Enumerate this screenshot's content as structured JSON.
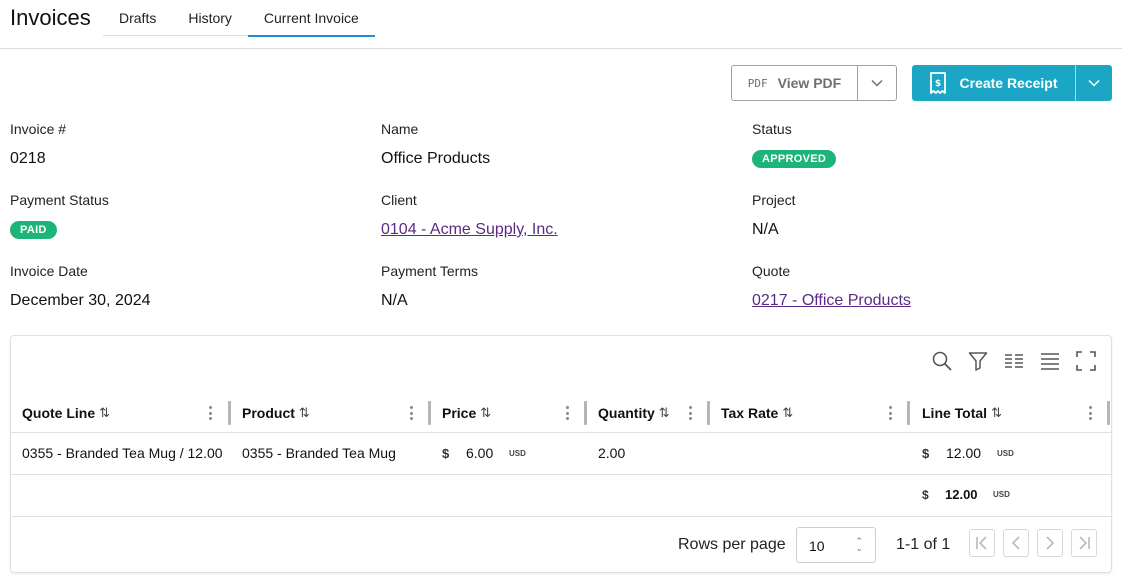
{
  "app": {
    "title": "Invoices"
  },
  "tabs": [
    {
      "label": "Drafts"
    },
    {
      "label": "History"
    },
    {
      "label": "Current Invoice",
      "active": true
    }
  ],
  "actions": {
    "pdf_icon_text": "PDF",
    "view_pdf_label": "View PDF",
    "create_receipt_label": "Create Receipt",
    "accent_color": "#1aa6c4"
  },
  "details": {
    "invoice_number": {
      "label": "Invoice #",
      "value": "0218"
    },
    "name": {
      "label": "Name",
      "value": "Office Products"
    },
    "status": {
      "label": "Status",
      "value": "APPROVED",
      "color": "#1db47a"
    },
    "payment_status": {
      "label": "Payment Status",
      "value": "PAID",
      "color": "#1db47a"
    },
    "client": {
      "label": "Client",
      "value": "0104 - Acme Supply, Inc."
    },
    "project": {
      "label": "Project",
      "value": "N/A"
    },
    "invoice_date": {
      "label": "Invoice Date",
      "value": "December 30, 2024"
    },
    "payment_terms": {
      "label": "Payment Terms",
      "value": "N/A"
    },
    "quote": {
      "label": "Quote",
      "value": "0217 - Office Products"
    }
  },
  "grid": {
    "columns": {
      "quote_line": "Quote Line",
      "product": "Product",
      "price": "Price",
      "quantity": "Quantity",
      "tax_rate": "Tax Rate",
      "line_total": "Line Total"
    },
    "sort_glyph": "⇅",
    "rows": [
      {
        "quote_line": "0355 - Branded Tea Mug / 12.00",
        "product": "0355 - Branded Tea Mug",
        "price_symbol": "$",
        "price": "6.00",
        "price_unit": "USD",
        "quantity": "2.00",
        "tax_rate": "",
        "total_symbol": "$",
        "line_total": "12.00",
        "total_unit": "USD"
      }
    ],
    "summary": {
      "symbol": "$",
      "total": "12.00",
      "unit": "USD"
    },
    "footer": {
      "rows_per_page_label": "Rows per page",
      "rows_per_page_value": "10",
      "page_info": "1-1 of 1"
    }
  }
}
